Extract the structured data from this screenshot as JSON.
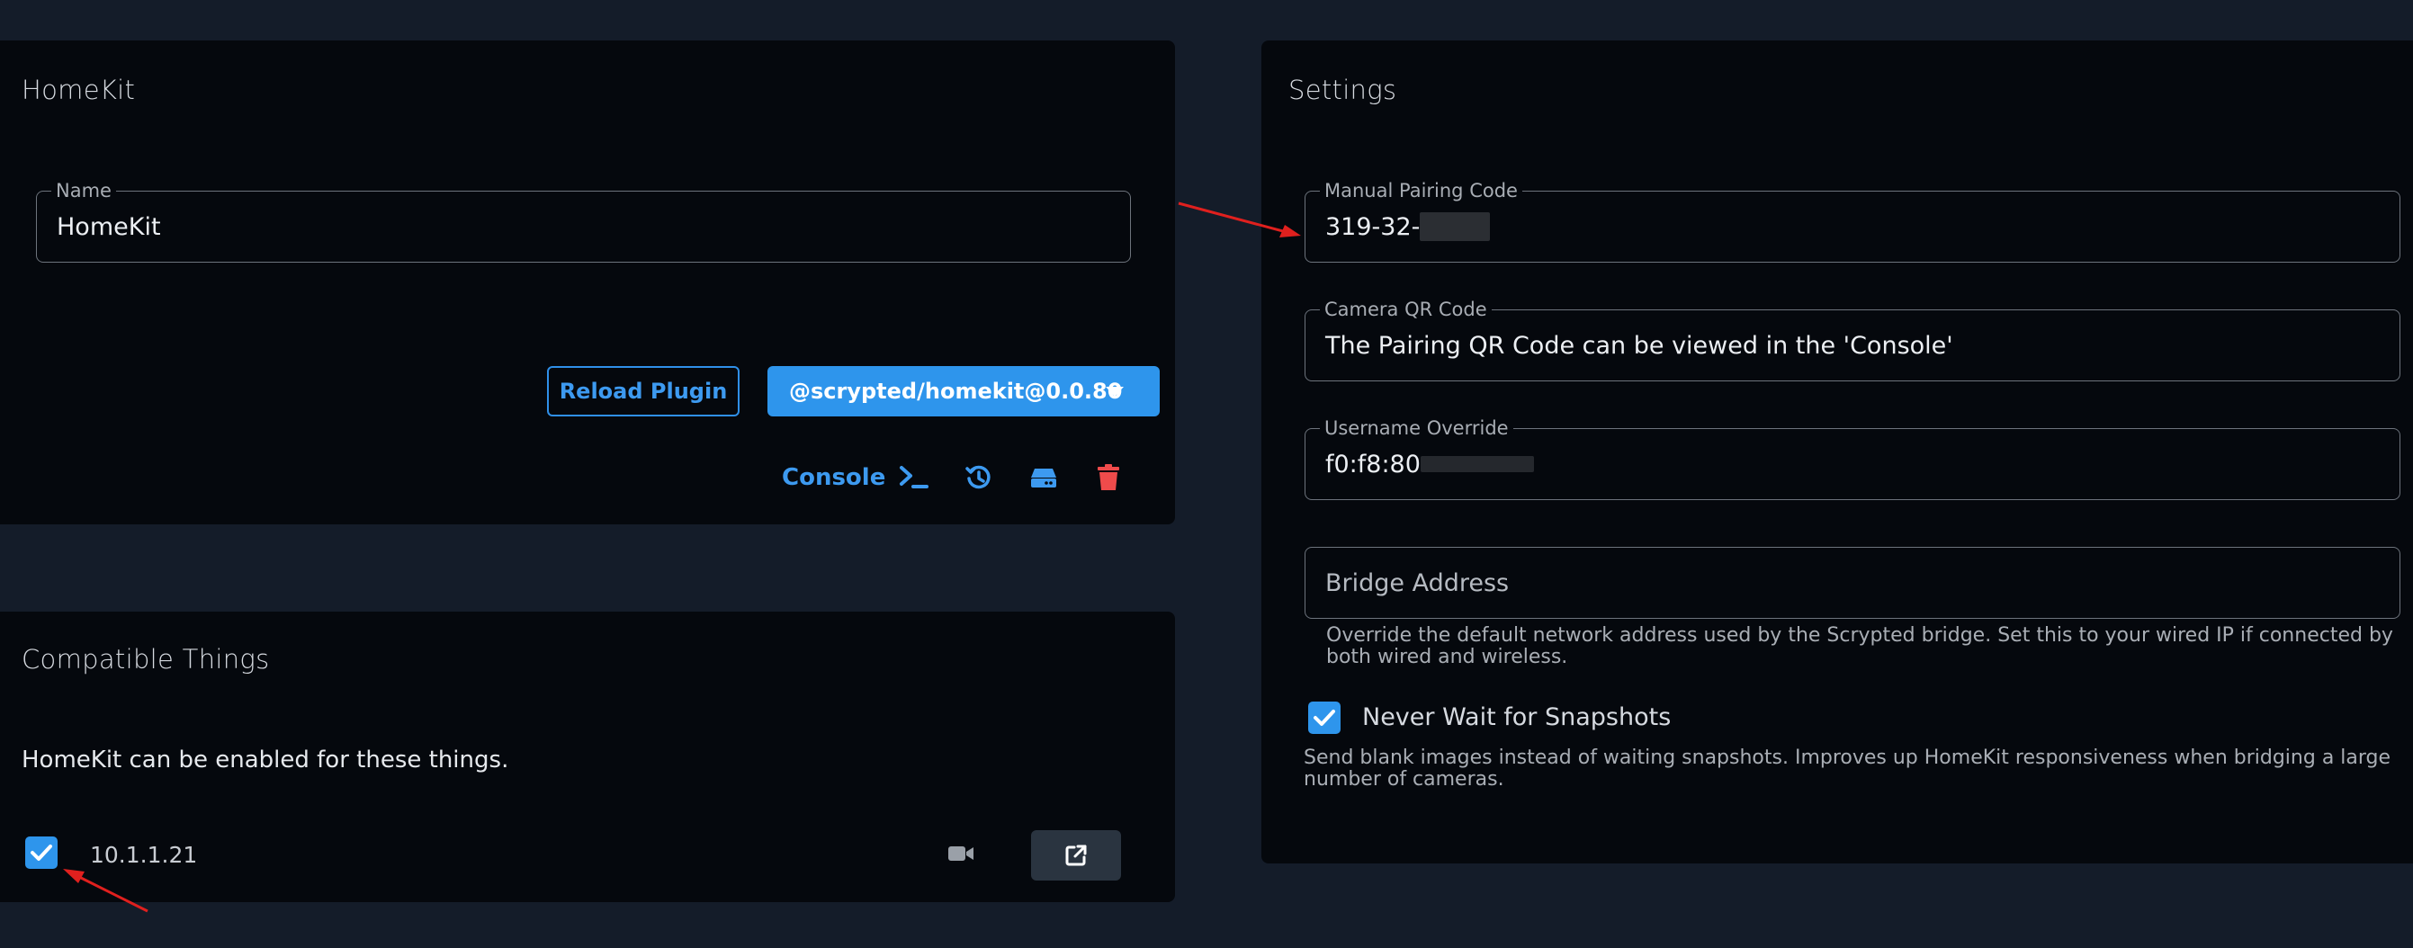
{
  "homekit_card": {
    "title": "HomeKit",
    "name_field": {
      "label": "Name",
      "value": "HomeKit"
    },
    "reload_button": "Reload Plugin",
    "version_button": "@scrypted/homekit@0.0.80",
    "console_link": "Console",
    "icons": [
      "terminal-icon",
      "history-icon",
      "storage-icon",
      "delete-icon"
    ]
  },
  "compatible_card": {
    "title": "Compatible Things",
    "description": "HomeKit can be enabled for these things.",
    "items": [
      {
        "label": "10.1.1.21",
        "checked": true,
        "type_icon": "camera-icon",
        "action_icon": "open-external-icon"
      }
    ]
  },
  "settings_card": {
    "title": "Settings",
    "pairing_code": {
      "label": "Manual Pairing Code",
      "value": "319-32-"
    },
    "qr_code": {
      "label": "Camera QR Code",
      "value": "The Pairing QR Code can be viewed in the 'Console'"
    },
    "username_override": {
      "label": "Username Override",
      "value": "f0:f8:80"
    },
    "bridge_address": {
      "placeholder": "Bridge Address",
      "help": "Override the default network address used by the Scrypted bridge. Set this to your wired IP if connected by both wired and wireless."
    },
    "snapshots": {
      "label": "Never Wait for Snapshots",
      "checked": true,
      "help": "Send blank images instead of waiting snapshots. Improves up HomeKit responsiveness when bridging a large number of cameras."
    }
  },
  "colors": {
    "background": "#141c29",
    "card": "#05080d",
    "accent": "#2e95ec",
    "danger": "#ef4b4b",
    "annotation": "#e0201e"
  }
}
